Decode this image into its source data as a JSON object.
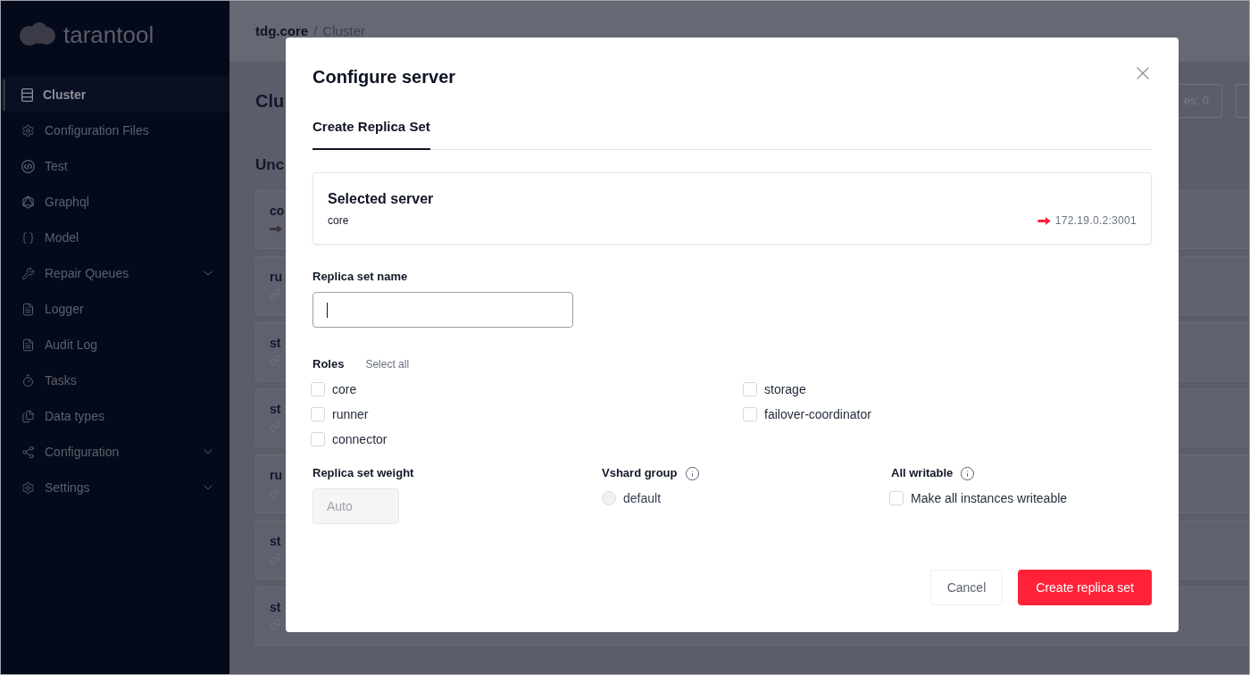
{
  "sidebar": {
    "logo": "tarantool",
    "items": [
      {
        "label": "Cluster",
        "selected": true,
        "submenu": false
      },
      {
        "label": "Configuration Files",
        "selected": false,
        "submenu": false
      },
      {
        "label": "Test",
        "selected": false,
        "submenu": false
      },
      {
        "label": "Graphql",
        "selected": false,
        "submenu": false
      },
      {
        "label": "Model",
        "selected": false,
        "submenu": false
      },
      {
        "label": "Repair Queues",
        "selected": false,
        "submenu": true
      },
      {
        "label": "Logger",
        "selected": false,
        "submenu": false
      },
      {
        "label": "Audit Log",
        "selected": false,
        "submenu": false
      },
      {
        "label": "Tasks",
        "selected": false,
        "submenu": false
      },
      {
        "label": "Data types",
        "selected": false,
        "submenu": false
      },
      {
        "label": "Configuration",
        "selected": false,
        "submenu": true
      },
      {
        "label": "Settings",
        "selected": false,
        "submenu": true
      }
    ]
  },
  "header": {
    "breadcrumb": [
      {
        "label": "tdg.core",
        "current": false
      },
      {
        "label": "Cluster",
        "current": true
      }
    ],
    "separator": "/"
  },
  "page": {
    "title": "Clu",
    "toolbar_button": "es: 0",
    "section_title": "Unc",
    "servers": [
      {
        "name": "co",
        "kind": "arrow"
      },
      {
        "name": "ru",
        "kind": "link"
      },
      {
        "name": "st",
        "kind": "link"
      },
      {
        "name": "st",
        "kind": "link"
      },
      {
        "name": "ru",
        "kind": "link"
      },
      {
        "name": "st",
        "kind": "link"
      },
      {
        "name": "st",
        "kind": "link"
      }
    ]
  },
  "modal": {
    "title": "Configure server",
    "tabs": [
      {
        "label": "Create Replica Set",
        "selected": true
      }
    ],
    "selected_server": {
      "heading": "Selected server",
      "alias": "core",
      "uri": "172.19.0.2:3001"
    },
    "replica_set_name": {
      "label": "Replica set name",
      "focused": true
    },
    "roles": {
      "label": "Roles",
      "select_all": "Select all",
      "options": [
        {
          "label": "core",
          "checked": false
        },
        {
          "label": "runner",
          "checked": false
        },
        {
          "label": "connector",
          "checked": false
        },
        {
          "label": "storage",
          "checked": false
        },
        {
          "label": "failover-coordinator",
          "checked": false
        }
      ]
    },
    "weight": {
      "label": "Replica set weight",
      "placeholder": "Auto",
      "disabled": true
    },
    "vshard_group": {
      "label": "Vshard group",
      "options": [
        {
          "label": "default",
          "selected": false,
          "disabled": true
        }
      ]
    },
    "all_writable": {
      "label": "All writable",
      "option": {
        "label": "Make all instances writeable",
        "checked": false
      }
    },
    "buttons": [
      {
        "label": "Cancel",
        "kind": "secondary"
      },
      {
        "label": "Create replica set",
        "kind": "primary"
      }
    ]
  }
}
